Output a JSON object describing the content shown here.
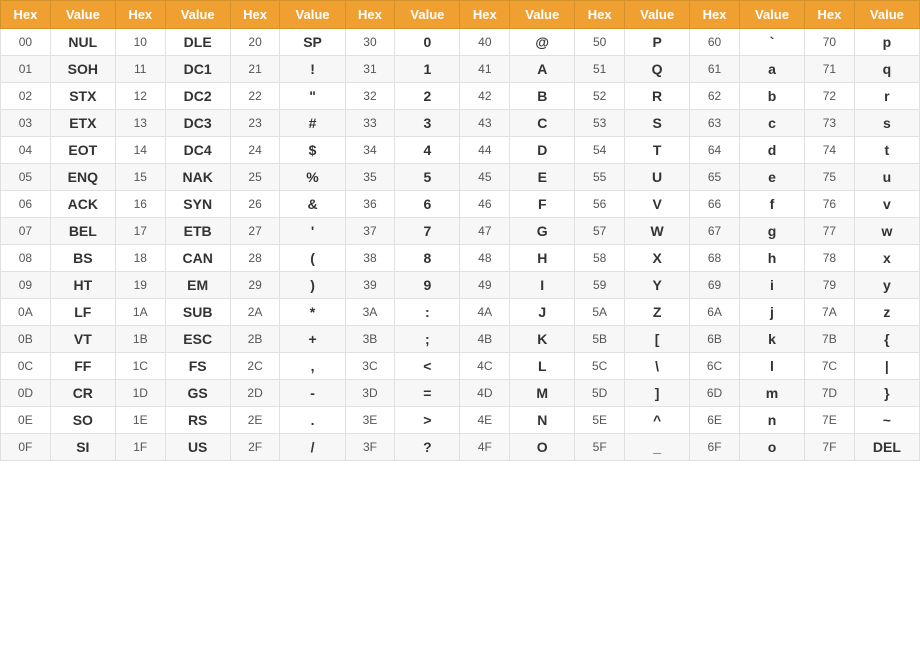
{
  "table": {
    "headers": [
      "Hex",
      "Value",
      "Hex",
      "Value",
      "Hex",
      "Value",
      "Hex",
      "Value",
      "Hex",
      "Value",
      "Hex",
      "Value",
      "Hex",
      "Value",
      "Hex",
      "Value"
    ],
    "rows": [
      [
        "00",
        "NUL",
        "10",
        "DLE",
        "20",
        "SP",
        "30",
        "0",
        "40",
        "@",
        "50",
        "P",
        "60",
        "`",
        "70",
        "p"
      ],
      [
        "01",
        "SOH",
        "11",
        "DC1",
        "21",
        "!",
        "31",
        "1",
        "41",
        "A",
        "51",
        "Q",
        "61",
        "a",
        "71",
        "q"
      ],
      [
        "02",
        "STX",
        "12",
        "DC2",
        "22",
        "\"",
        "32",
        "2",
        "42",
        "B",
        "52",
        "R",
        "62",
        "b",
        "72",
        "r"
      ],
      [
        "03",
        "ETX",
        "13",
        "DC3",
        "23",
        "#",
        "33",
        "3",
        "43",
        "C",
        "53",
        "S",
        "63",
        "c",
        "73",
        "s"
      ],
      [
        "04",
        "EOT",
        "14",
        "DC4",
        "24",
        "$",
        "34",
        "4",
        "44",
        "D",
        "54",
        "T",
        "64",
        "d",
        "74",
        "t"
      ],
      [
        "05",
        "ENQ",
        "15",
        "NAK",
        "25",
        "%",
        "35",
        "5",
        "45",
        "E",
        "55",
        "U",
        "65",
        "e",
        "75",
        "u"
      ],
      [
        "06",
        "ACK",
        "16",
        "SYN",
        "26",
        "&",
        "36",
        "6",
        "46",
        "F",
        "56",
        "V",
        "66",
        "f",
        "76",
        "v"
      ],
      [
        "07",
        "BEL",
        "17",
        "ETB",
        "27",
        "'",
        "37",
        "7",
        "47",
        "G",
        "57",
        "W",
        "67",
        "g",
        "77",
        "w"
      ],
      [
        "08",
        "BS",
        "18",
        "CAN",
        "28",
        "(",
        "38",
        "8",
        "48",
        "H",
        "58",
        "X",
        "68",
        "h",
        "78",
        "x"
      ],
      [
        "09",
        "HT",
        "19",
        "EM",
        "29",
        ")",
        "39",
        "9",
        "49",
        "I",
        "59",
        "Y",
        "69",
        "i",
        "79",
        "y"
      ],
      [
        "0A",
        "LF",
        "1A",
        "SUB",
        "2A",
        "*",
        "3A",
        ":",
        "4A",
        "J",
        "5A",
        "Z",
        "6A",
        "j",
        "7A",
        "z"
      ],
      [
        "0B",
        "VT",
        "1B",
        "ESC",
        "2B",
        "+",
        "3B",
        ";",
        "4B",
        "K",
        "5B",
        "[",
        "6B",
        "k",
        "7B",
        "{"
      ],
      [
        "0C",
        "FF",
        "1C",
        "FS",
        "2C",
        ",",
        "3C",
        "<",
        "4C",
        "L",
        "5C",
        "\\",
        "6C",
        "l",
        "7C",
        "|"
      ],
      [
        "0D",
        "CR",
        "1D",
        "GS",
        "2D",
        "-",
        "3D",
        "=",
        "4D",
        "M",
        "5D",
        "]",
        "6D",
        "m",
        "7D",
        "}"
      ],
      [
        "0E",
        "SO",
        "1E",
        "RS",
        "2E",
        ".",
        "3E",
        ">",
        "4E",
        "N",
        "5E",
        "^",
        "6E",
        "n",
        "7E",
        "~"
      ],
      [
        "0F",
        "SI",
        "1F",
        "US",
        "2F",
        "/",
        "3F",
        "?",
        "4F",
        "O",
        "5F",
        "_",
        "6F",
        "o",
        "7F",
        "DEL"
      ]
    ]
  }
}
